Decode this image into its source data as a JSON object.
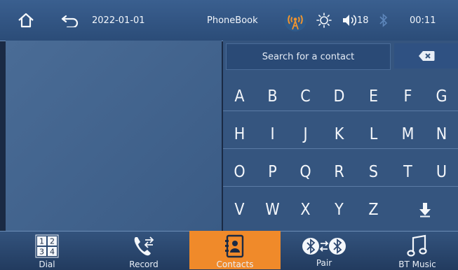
{
  "status_bar": {
    "date": "2022-01-01",
    "title": "PhoneBook",
    "volume": "18",
    "time": "00:11"
  },
  "search": {
    "placeholder": "Search for a contact"
  },
  "keyboard": {
    "rows": [
      [
        "A",
        "B",
        "C",
        "D",
        "E",
        "F",
        "G"
      ],
      [
        "H",
        "I",
        "J",
        "K",
        "L",
        "M",
        "N"
      ],
      [
        "O",
        "P",
        "Q",
        "R",
        "S",
        "T",
        "U"
      ],
      [
        "V",
        "W",
        "X",
        "Y",
        "Z"
      ]
    ]
  },
  "nav": {
    "dial": "Dial",
    "record": "Record",
    "contacts": "Contacts",
    "pair": "Pair",
    "bt_music": "BT Music",
    "dial_digits": [
      "1",
      "2",
      "3",
      "4"
    ],
    "active": "contacts"
  },
  "colors": {
    "accent": "#f08a2a",
    "bar": "#2b4c78",
    "keyboard": "#35557f"
  }
}
